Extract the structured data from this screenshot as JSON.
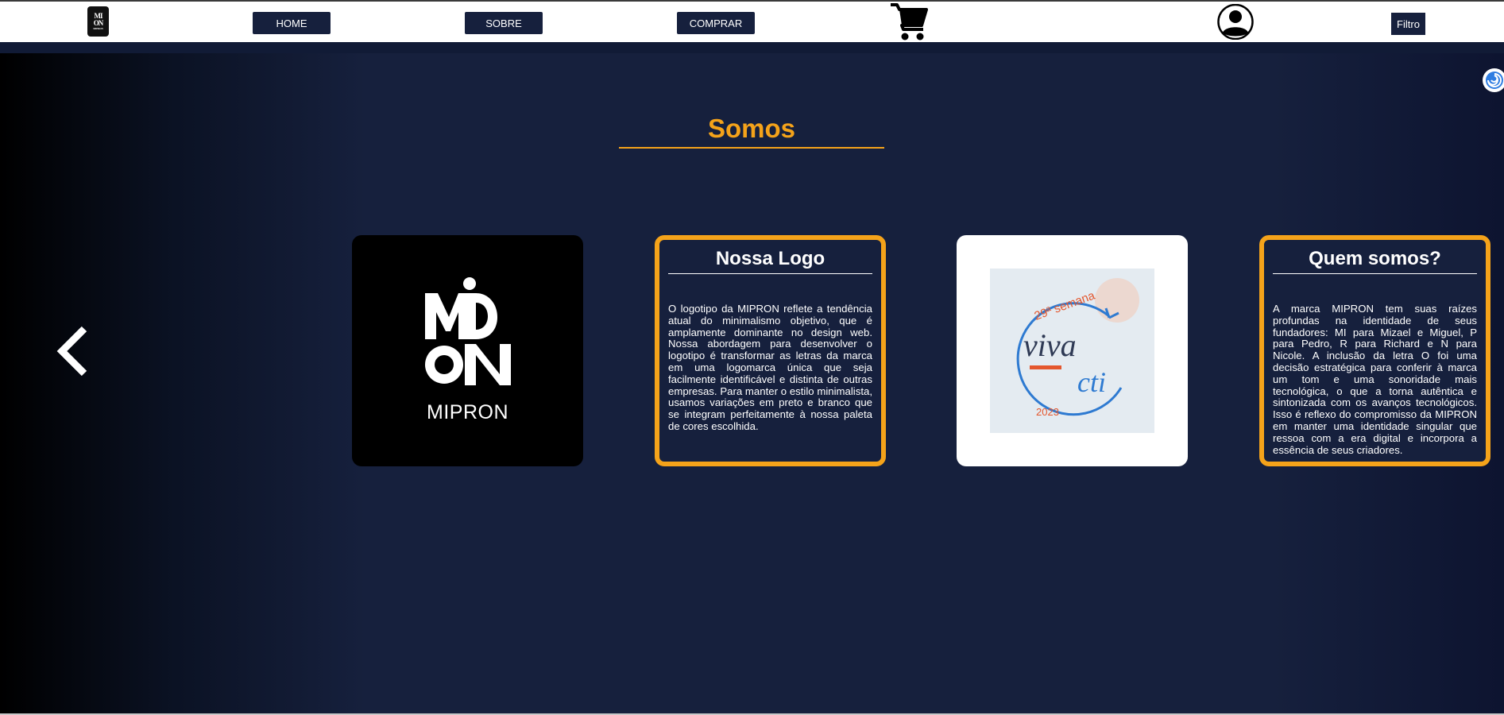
{
  "nav": {
    "logo_text_top": "MI",
    "logo_text_mid": "ON",
    "logo_text_small": "MIPRON",
    "buttons": [
      {
        "label": "HOME"
      },
      {
        "label": "SOBRE"
      },
      {
        "label": "COMPRAR"
      }
    ],
    "cart_icon": "shopping-cart-icon",
    "user_icon": "user-avatar-icon",
    "filter_label": "Filtro"
  },
  "section": {
    "title": "Somos"
  },
  "carousel": {
    "prev_icon": "chevron-left-icon",
    "logo_card": {
      "brand_word": "MIPRON"
    },
    "cards": [
      {
        "title": "Nossa Logo",
        "body": "O logotipo da MIPRON reflete a tendência atual do minimalismo objetivo, que é amplamente dominante no design web. Nossa abordagem para desenvolver o logotipo é transformar as letras da marca em uma logomarca única que seja facilmente identificável e distinta de outras empresas. Para manter o estilo minimalista, usamos variações em preto e branco que se integram perfeitamente à nossa paleta de cores escolhida."
      },
      {
        "title": "Quem somos?",
        "body": "A marca MIPRON tem suas raízes profundas na identidade de seus fundadores: MI para Mizael e Miguel, P para Pedro, R para Richard e N para Nicole. A inclusão da letra O foi uma decisão estratégica para conferir à marca um tom e uma sonoridade mais tecnológica, o que a torna autêntica e sintonizada com os avanços tecnológicos. Isso é reflexo do compromisso da MIPRON em manter uma identidade singular que ressoa com a era digital e incorpora a essência de seus criadores."
      }
    ],
    "event_image": {
      "line1": "29ª semana",
      "line2": "viva",
      "line3": "cti",
      "line4": "2023"
    }
  },
  "colors": {
    "navy": "#16203d",
    "accent": "#f5a31a",
    "white": "#ffffff"
  }
}
